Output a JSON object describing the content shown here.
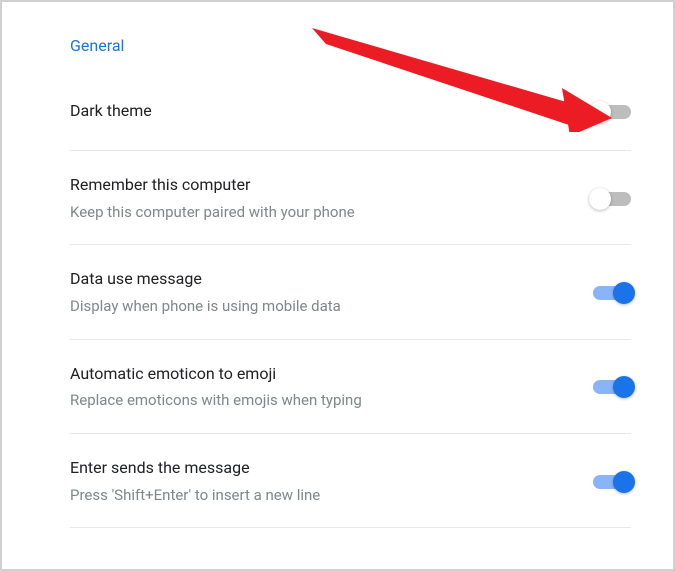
{
  "section_header": "General",
  "settings": [
    {
      "title": "Dark theme",
      "desc": "",
      "enabled": false
    },
    {
      "title": "Remember this computer",
      "desc": "Keep this computer paired with your phone",
      "enabled": false
    },
    {
      "title": "Data use message",
      "desc": "Display when phone is using mobile data",
      "enabled": true
    },
    {
      "title": "Automatic emoticon to emoji",
      "desc": "Replace emoticons with emojis when typing",
      "enabled": true
    },
    {
      "title": "Enter sends the message",
      "desc": "Press 'Shift+Enter' to insert a new line",
      "enabled": true
    }
  ],
  "annotation": {
    "color": "#ec1c24"
  }
}
